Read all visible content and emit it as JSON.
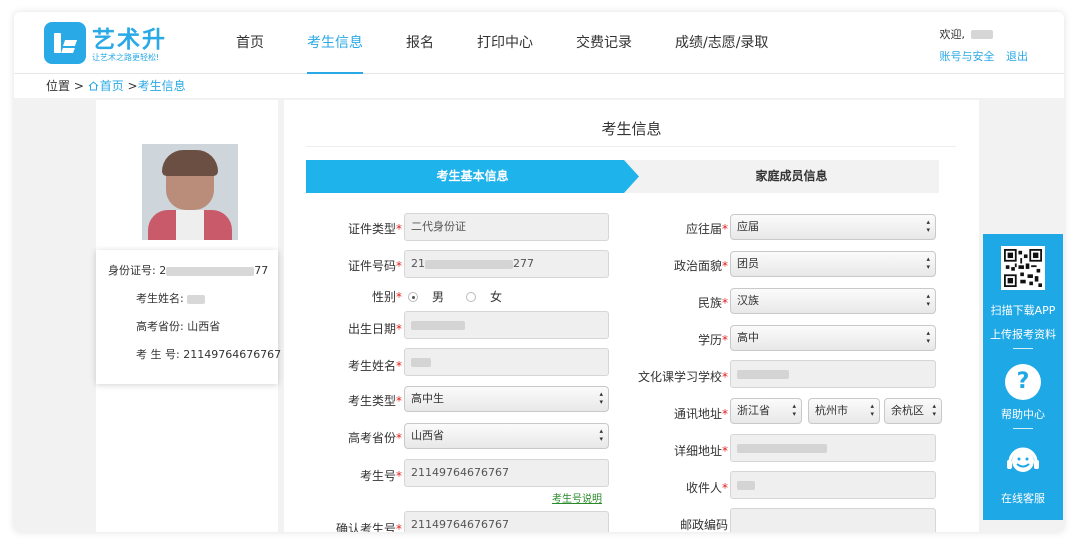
{
  "header": {
    "logo_name": "艺术升",
    "logo_slogan": "让艺术之路更轻松!",
    "nav": [
      {
        "label": "首页",
        "active": false
      },
      {
        "label": "考生信息",
        "active": true
      },
      {
        "label": "报名",
        "active": false
      },
      {
        "label": "打印中心",
        "active": false
      },
      {
        "label": "交费记录",
        "active": false
      },
      {
        "label": "成绩/志愿/录取",
        "active": false
      }
    ],
    "user": {
      "welcome": "欢迎,",
      "account_link": "账号与安全",
      "logout_link": "退出"
    }
  },
  "breadcrumb": {
    "prefix": "位置 >",
    "home": "首页",
    "separator": ">",
    "current": "考生信息"
  },
  "profile_card": {
    "id_label": "身份证号:",
    "id_start": "2",
    "id_end": "77",
    "name_label": "考生姓名:",
    "province_label": "高考省份:",
    "province_value": "山西省",
    "exam_no_label": "考 生 号:",
    "exam_no_value": "21149764676767"
  },
  "main": {
    "title": "考生信息",
    "tabs": {
      "basic": "考生基本信息",
      "family": "家庭成员信息"
    },
    "left_fields": {
      "id_type": {
        "label": "证件类型",
        "value": "二代身份证"
      },
      "id_number": {
        "label": "证件号码",
        "value_start": "21",
        "value_end": "277"
      },
      "gender": {
        "label": "性别",
        "male": "男",
        "female": "女",
        "selected": "男"
      },
      "birth_date": {
        "label": "出生日期"
      },
      "name": {
        "label": "考生姓名"
      },
      "student_type": {
        "label": "考生类型",
        "value": "高中生"
      },
      "province": {
        "label": "高考省份",
        "value": "山西省"
      },
      "exam_no": {
        "label": "考生号",
        "value": "21149764676767",
        "hint": "考生号说明"
      },
      "confirm_exam_no": {
        "label": "确认考生号",
        "value": "21149764676767"
      }
    },
    "right_fields": {
      "graduation": {
        "label": "应往届",
        "value": "应届"
      },
      "political": {
        "label": "政治面貌",
        "value": "团员"
      },
      "ethnicity": {
        "label": "民族",
        "value": "汉族"
      },
      "education": {
        "label": "学历",
        "value": "高中"
      },
      "school": {
        "label": "文化课学习学校"
      },
      "address": {
        "label": "通讯地址",
        "province": "浙江省",
        "city": "杭州市",
        "district": "余杭区"
      },
      "detail_address": {
        "label": "详细地址"
      },
      "recipient": {
        "label": "收件人"
      },
      "postal_code": {
        "label": "邮政编码"
      }
    },
    "required_mark": "*"
  },
  "float_bar": {
    "download_app": "扫描下载APP",
    "upload_materials": "上传报考资料",
    "help_center": "帮助中心",
    "help_glyph": "?",
    "online_service": "在线客服"
  },
  "colors": {
    "accent": "#29a9e6",
    "tab_active": "#1fb3ec",
    "required": "#e02020",
    "hint_link": "#2a8a2a"
  }
}
